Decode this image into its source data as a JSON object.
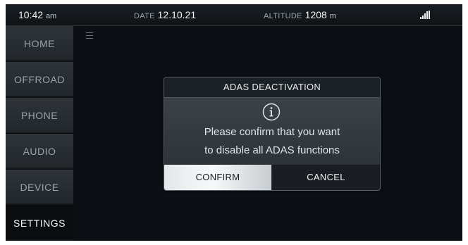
{
  "status_bar": {
    "time": "10:42",
    "time_suffix": "am",
    "date_label": "DATE",
    "date_value": "12.10.21",
    "altitude_label": "ALTITUDE",
    "altitude_value": "1208",
    "altitude_unit": "m",
    "signal_icon": "signal-strength-icon"
  },
  "sidebar": {
    "items": [
      {
        "label": "HOME",
        "active": false
      },
      {
        "label": "OFFROAD",
        "active": false
      },
      {
        "label": "PHONE",
        "active": false
      },
      {
        "label": "AUDIO",
        "active": false
      },
      {
        "label": "DEVICE",
        "active": false
      },
      {
        "label": "SETTINGS",
        "active": true
      }
    ]
  },
  "menu_icon": "hamburger-menu-icon",
  "dialog": {
    "title": "ADAS DEACTIVATION",
    "icon": "info-icon",
    "message_line1": "Please confirm that you want",
    "message_line2": "to disable all ADAS functions",
    "confirm_label": "CONFIRM",
    "cancel_label": "CANCEL"
  },
  "colors": {
    "background": "#0c1014",
    "dialog_body": "#363c41",
    "confirm_button": "#eef0f2",
    "cancel_button": "#1a1e22",
    "text_light": "#e8ecef"
  }
}
